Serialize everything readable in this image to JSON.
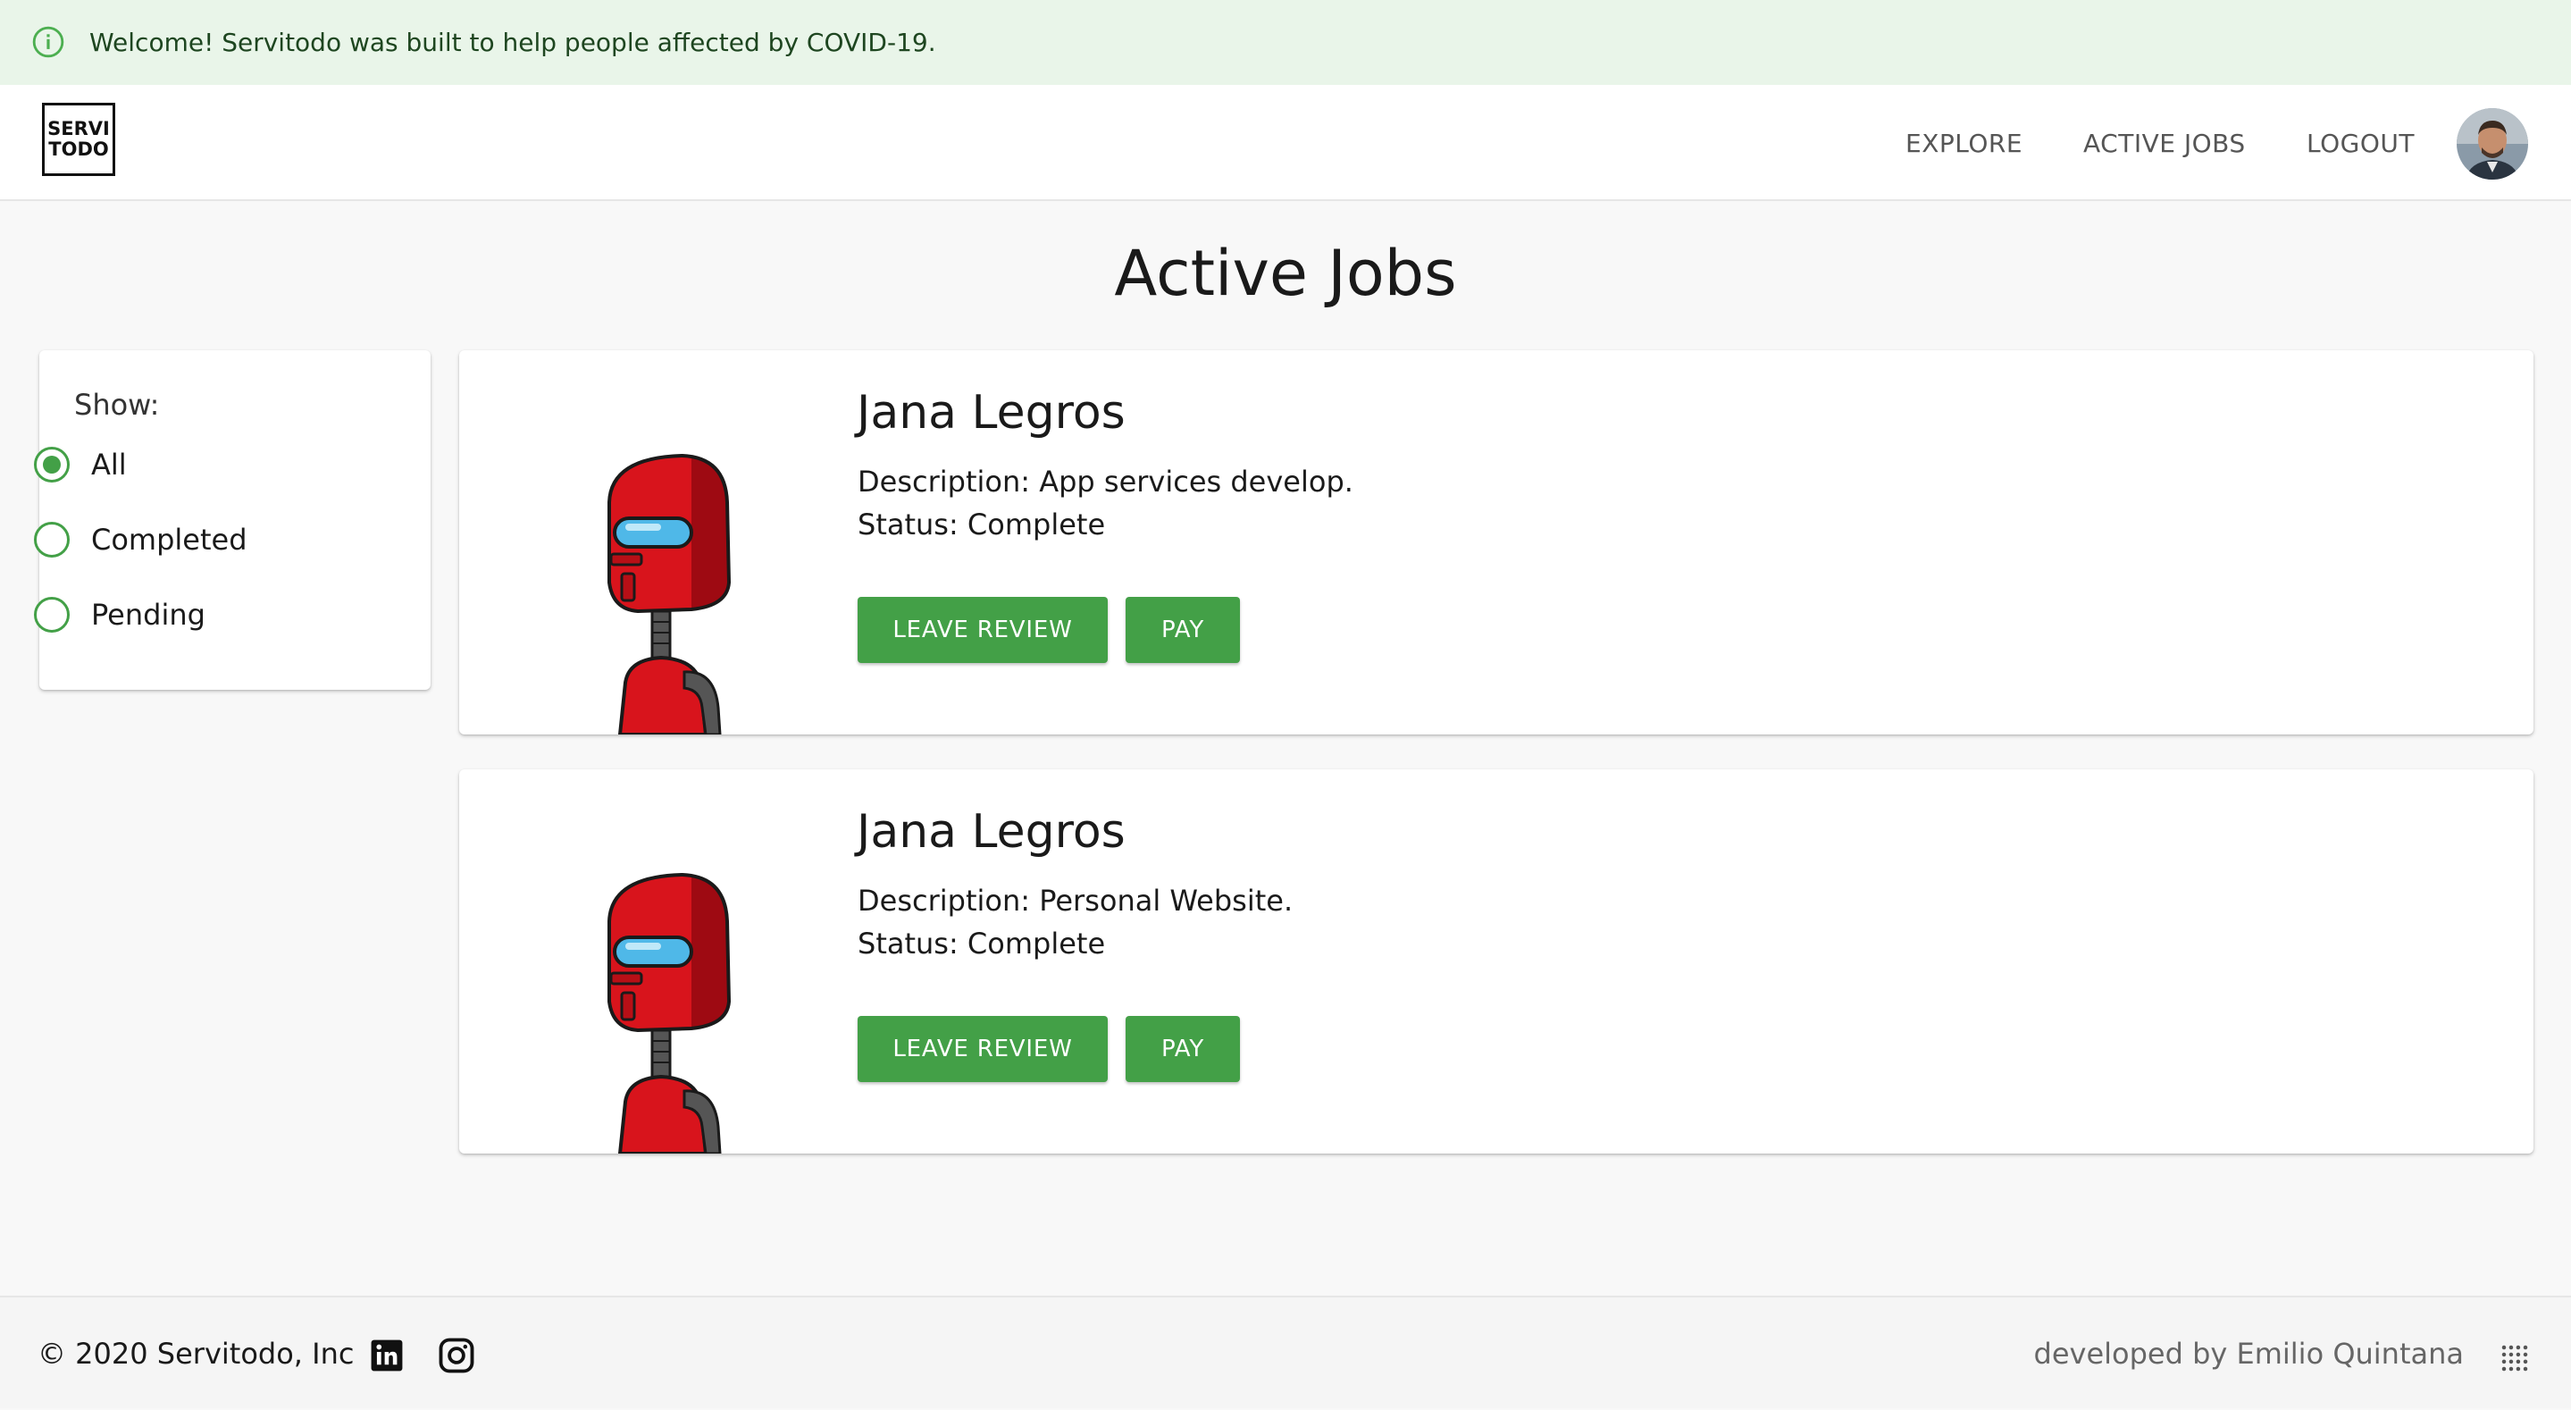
{
  "banner": {
    "message": "Welcome! Servitodo was built to help people affected by COVID-19.",
    "icon": "info-icon",
    "color": "#e9f5e9"
  },
  "header": {
    "logo_line1": "SERVI",
    "logo_line2": "TODO",
    "nav": {
      "explore": "EXPLORE",
      "active_jobs": "ACTIVE JOBS",
      "logout": "LOGOUT"
    },
    "avatar": "user-avatar"
  },
  "page": {
    "title": "Active Jobs"
  },
  "filter": {
    "label": "Show:",
    "options": [
      {
        "label": "All",
        "selected": true
      },
      {
        "label": "Completed",
        "selected": false
      },
      {
        "label": "Pending",
        "selected": false
      }
    ],
    "accent": "#43a047"
  },
  "jobs": [
    {
      "name": "Jana Legros",
      "description": "Description: App services develop.",
      "status": "Status: Complete",
      "review_label": "LEAVE REVIEW",
      "pay_label": "PAY",
      "image": "red-robot-illustration"
    },
    {
      "name": "Jana Legros",
      "description": "Description: Personal Website.",
      "status": "Status: Complete",
      "review_label": "LEAVE REVIEW",
      "pay_label": "PAY",
      "image": "red-robot-illustration"
    }
  ],
  "footer": {
    "copyright": "© 2020 Servitodo, Inc",
    "credit": "developed by Emilio Quintana",
    "icons": [
      "linkedin-icon",
      "instagram-icon",
      "dots-grid-icon"
    ]
  }
}
